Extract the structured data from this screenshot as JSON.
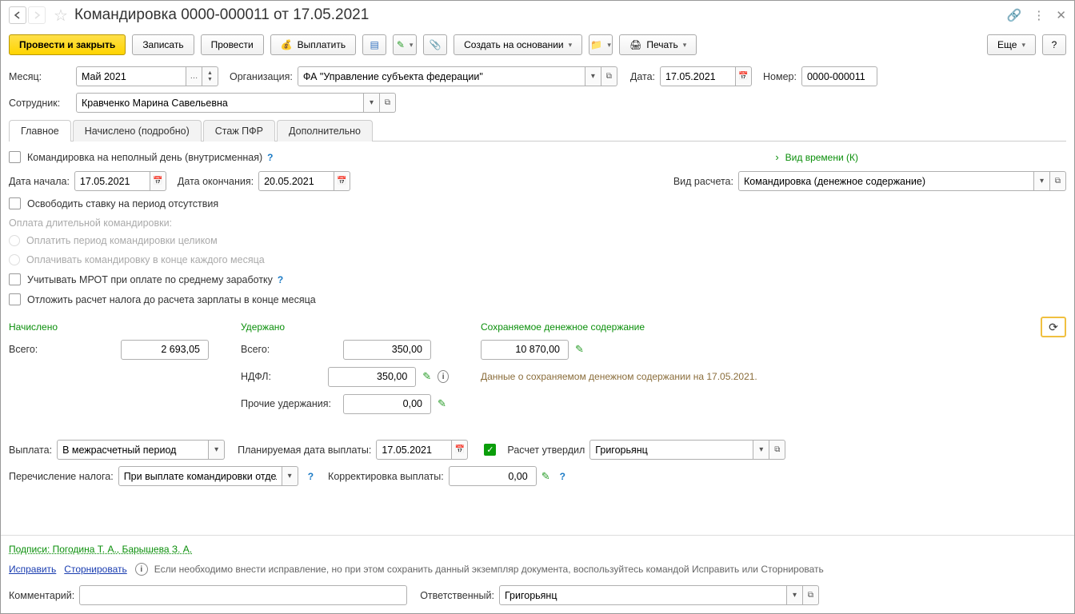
{
  "title": "Командировка 0000-000011 от 17.05.2021",
  "toolbar": {
    "post_close": "Провести и закрыть",
    "write": "Записать",
    "post": "Провести",
    "pay": "Выплатить",
    "create_based": "Создать на основании",
    "print": "Печать",
    "more": "Еще"
  },
  "header": {
    "month_lbl": "Месяц:",
    "month_val": "Май 2021",
    "org_lbl": "Организация:",
    "org_val": "ФА \"Управление субъекта федерации\"",
    "date_lbl": "Дата:",
    "date_val": "17.05.2021",
    "num_lbl": "Номер:",
    "num_val": "0000-000011",
    "emp_lbl": "Сотрудник:",
    "emp_val": "Кравченко Марина Савельевна"
  },
  "tabs": {
    "main": "Главное",
    "accrued": "Начислено (подробно)",
    "pension": "Стаж ПФР",
    "extra": "Дополнительно"
  },
  "main": {
    "partial_day": "Командировка на неполный день (внутрисменная)",
    "time_kind": "Вид времени (К)",
    "start_lbl": "Дата начала:",
    "start_val": "17.05.2021",
    "end_lbl": "Дата окончания:",
    "end_val": "20.05.2021",
    "calc_lbl": "Вид расчета:",
    "calc_val": "Командировка (денежное содержание)",
    "release_rate": "Освободить ставку на период отсутствия",
    "long_trip": "Оплата длительной командировки:",
    "pay_whole": "Оплатить период командировки целиком",
    "pay_monthly": "Оплачивать командировку в конце каждого месяца",
    "mrot": "Учитывать МРОТ при оплате по среднему заработку",
    "defer_tax": "Отложить расчет налога до расчета зарплаты в конце месяца",
    "accrued_hdr": "Начислено",
    "withheld_hdr": "Удержано",
    "kept_hdr": "Сохраняемое денежное содержание",
    "total_lbl": "Всего:",
    "accrued_total": "2 693,05",
    "withheld_total": "350,00",
    "ndfl_lbl": "НДФЛ:",
    "ndfl_val": "350,00",
    "other_lbl": "Прочие удержания:",
    "other_val": "0,00",
    "kept_val": "10 870,00",
    "kept_note": "Данные о сохраняемом денежном содержании на 17.05.2021.",
    "payout_lbl": "Выплата:",
    "payout_val": "В межрасчетный период",
    "planned_lbl": "Планируемая дата выплаты:",
    "planned_val": "17.05.2021",
    "approved_lbl": "Расчет утвердил",
    "approved_val": "Григорьянц",
    "tax_transfer_lbl": "Перечисление налога:",
    "tax_transfer_val": "При выплате командировки отдел",
    "corr_lbl": "Корректировка выплаты:",
    "corr_val": "0,00"
  },
  "footer": {
    "signatures": "Подписи: Погодина Т. А., Барышева З. А.",
    "fix": "Исправить",
    "storno": "Сторнировать",
    "note": "Если необходимо внести исправление, но при этом сохранить данный экземпляр документа, воспользуйтесь командой Исправить или Сторнировать",
    "comment_lbl": "Комментарий:",
    "responsible_lbl": "Ответственный:",
    "responsible_val": "Григорьянц"
  }
}
